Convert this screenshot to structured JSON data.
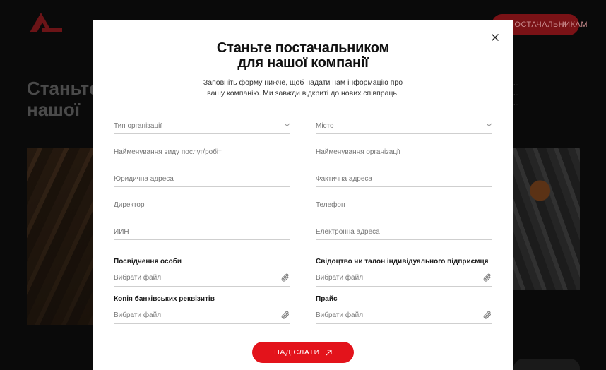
{
  "background": {
    "cta_label": "ПОСТАЧАЛЬНИКАМ",
    "heading_lines": [
      "Станьте",
      "нашої"
    ],
    "paragraph_lines": [
      "...",
      "...",
      "...",
      "..."
    ]
  },
  "modal": {
    "title_lines": [
      "Станьте постачальником",
      "для нашої компанії"
    ],
    "subtitle_lines": [
      "Заповніть форму нижче, щоб надати нам інформацію про",
      "вашу компанію. Ми завжди відкриті до нових співпраць."
    ],
    "fields": {
      "org_type": "Тип організації",
      "city": "Місто",
      "service_type": "Найменування виду послуг/робіт",
      "org_name": "Найменування організації",
      "legal_address": "Юридична адреса",
      "actual_address": "Фактична адреса",
      "director": "Директор",
      "phone": "Телефон",
      "iin": "ИИН",
      "email": "Електронна адреса"
    },
    "files": {
      "id_label": "Посвідчення особи",
      "id_placeholder": "Вибрати файл",
      "certificate_label": "Свідоцтво чи талон індивідуального підприємця",
      "certificate_placeholder": "Вибрати файл",
      "bank_label": "Копія банківських реквізитів",
      "bank_placeholder": "Вибрати файл",
      "price_label": "Прайс",
      "price_placeholder": "Вибрати файл"
    },
    "submit_label": "НАДІСЛАТИ"
  },
  "colors": {
    "accent": "#e3131b",
    "overlay": "#0a0a0a",
    "modal_bg": "#ffffff"
  },
  "icons": {
    "close": "close-icon",
    "chevron": "chevron-down-icon",
    "attach": "paperclip-icon",
    "arrow": "arrow-up-right-icon"
  }
}
